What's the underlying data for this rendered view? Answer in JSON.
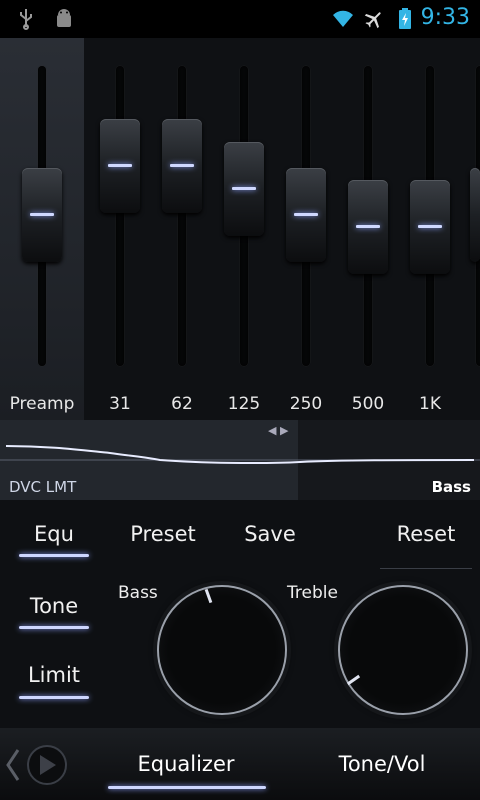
{
  "status_bar": {
    "time": "9:33",
    "icons": [
      "usb-icon",
      "android-debug-icon",
      "wifi-icon",
      "airplane-mode-icon",
      "battery-charging-icon"
    ]
  },
  "equalizer": {
    "preamp_label": "Preamp",
    "bands": [
      {
        "label": "31"
      },
      {
        "label": "62"
      },
      {
        "label": "125"
      },
      {
        "label": "250"
      },
      {
        "label": "500"
      },
      {
        "label": "1K"
      }
    ]
  },
  "curve": {
    "left_label": "DVC LMT",
    "right_label": "Bass"
  },
  "controls": {
    "equ_label": "Equ",
    "preset_label": "Preset",
    "save_label": "Save",
    "reset_label": "Reset",
    "tone_label": "Tone",
    "limit_label": "Limit",
    "bass_label": "Bass",
    "treble_label": "Treble"
  },
  "bottom_tabs": {
    "equalizer": "Equalizer",
    "tone_vol": "Tone/Vol"
  },
  "colors": {
    "accent": "#cdd6ff",
    "status_time": "#33b5e5"
  }
}
